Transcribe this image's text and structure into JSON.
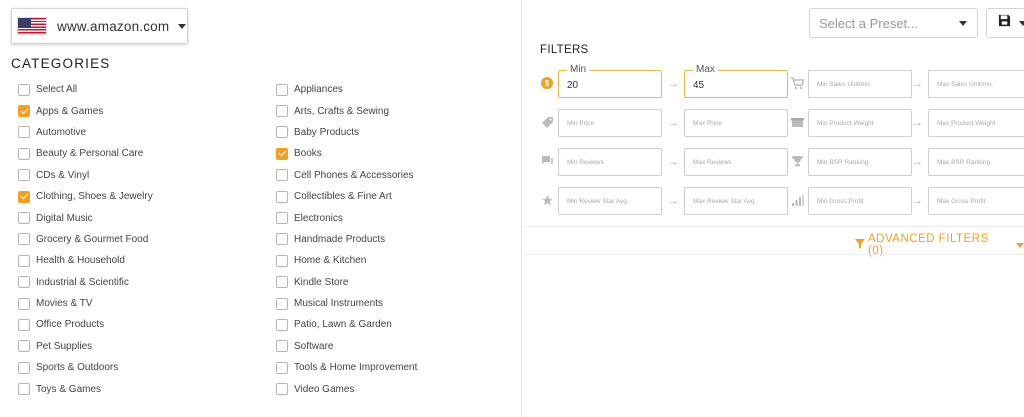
{
  "marketplace": {
    "label": "www.amazon.com",
    "flag": "us-flag-icon"
  },
  "categories": {
    "title": "CATEGORIES",
    "col1": [
      {
        "label": "Select All",
        "checked": false
      },
      {
        "label": "Apps & Games",
        "checked": true
      },
      {
        "label": "Automotive",
        "checked": false
      },
      {
        "label": "Beauty & Personal Care",
        "checked": false
      },
      {
        "label": "CDs & Vinyl",
        "checked": false
      },
      {
        "label": "Clothing, Shoes & Jewelry",
        "checked": true
      },
      {
        "label": "Digital Music",
        "checked": false
      },
      {
        "label": "Grocery & Gourmet Food",
        "checked": false
      },
      {
        "label": "Health & Household",
        "checked": false
      },
      {
        "label": "Industrial & Scientific",
        "checked": false
      },
      {
        "label": "Movies & TV",
        "checked": false
      },
      {
        "label": "Office Products",
        "checked": false
      },
      {
        "label": "Pet Supplies",
        "checked": false
      },
      {
        "label": "Sports & Outdoors",
        "checked": false
      },
      {
        "label": "Toys & Games",
        "checked": false
      }
    ],
    "col2": [
      {
        "label": "Appliances",
        "checked": false
      },
      {
        "label": "Arts, Crafts & Sewing",
        "checked": false
      },
      {
        "label": "Baby Products",
        "checked": false
      },
      {
        "label": "Books",
        "checked": true
      },
      {
        "label": "Cell Phones & Accessories",
        "checked": false
      },
      {
        "label": "Collectibles & Fine Art",
        "checked": false
      },
      {
        "label": "Electronics",
        "checked": false
      },
      {
        "label": "Handmade Products",
        "checked": false
      },
      {
        "label": "Home & Kitchen",
        "checked": false
      },
      {
        "label": "Kindle Store",
        "checked": false
      },
      {
        "label": "Musical Instruments",
        "checked": false
      },
      {
        "label": "Patio, Lawn & Garden",
        "checked": false
      },
      {
        "label": "Software",
        "checked": false
      },
      {
        "label": "Tools & Home Improvement",
        "checked": false
      },
      {
        "label": "Video Games",
        "checked": false
      }
    ]
  },
  "toolbar": {
    "preset_placeholder": "Select a Preset...",
    "save_icon": "floppy-disk-icon"
  },
  "filters": {
    "title": "FILTERS",
    "price_range": {
      "min_label": "Min",
      "max_label": "Max",
      "min_value": "20",
      "max_value": "45",
      "icon": "dollar-coin-icon"
    },
    "sales": {
      "min_placeholder": "Min Sales Unit/mo.",
      "max_placeholder": "Max Sales Unit/mo.",
      "icon": "cart-icon"
    },
    "price": {
      "min_placeholder": "Min Price",
      "max_placeholder": "Max Price",
      "icon": "price-tag-icon"
    },
    "weight": {
      "min_placeholder": "Min Product Weight",
      "max_placeholder": "Max Product Weight",
      "icon": "box-icon"
    },
    "reviews": {
      "min_placeholder": "Min Reviews",
      "max_placeholder": "Max Reviews",
      "icon": "chat-bubble-icon"
    },
    "bsr": {
      "min_placeholder": "Min BSR Ranking",
      "max_placeholder": "Max BSR Ranking",
      "icon": "trophy-icon"
    },
    "stars": {
      "min_placeholder": "Min Review Star Avg.",
      "max_placeholder": "Max Review Star Avg.",
      "icon": "star-icon"
    },
    "profit": {
      "min_placeholder": "Min Gross Profit",
      "max_placeholder": "Max Gross Profit",
      "icon": "bar-chart-icon"
    },
    "advanced_label": "ADVANCED FILTERS (0)",
    "accent_color": "#f0a01e"
  }
}
